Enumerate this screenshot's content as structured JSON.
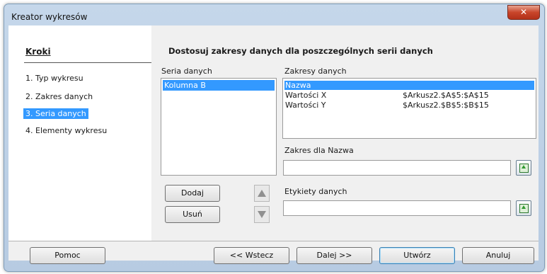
{
  "window": {
    "title": "Kreator wykresów",
    "close_label": "✕"
  },
  "steps": {
    "header": "Kroki",
    "items": [
      {
        "label": "1. Typ wykresu"
      },
      {
        "label": "2. Zakres danych"
      },
      {
        "label": "3. Seria danych"
      },
      {
        "label": "4. Elementy wykresu"
      }
    ],
    "selected_index": 2
  },
  "main": {
    "heading": "Dostosuj zakresy danych dla poszczególnych serii danych",
    "series_label": "Seria danych",
    "series_items": [
      "Kolumna B"
    ],
    "ranges_label": "Zakresy danych",
    "ranges": [
      {
        "name": "Nazwa",
        "value": ""
      },
      {
        "name": "Wartości X",
        "value": "$Arkusz2.$A$5:$A$15"
      },
      {
        "name": "Wartości Y",
        "value": "$Arkusz2.$B$5:$B$15"
      }
    ],
    "range_for_label": "Zakres dla Nazwa",
    "range_for_value": "",
    "data_labels_label": "Etykiety danych",
    "data_labels_value": "",
    "add_button": "Dodaj",
    "remove_button": "Usuń"
  },
  "footer": {
    "help": "Pomoc",
    "back": "<< Wstecz",
    "next": "Dalej >>",
    "finish": "Utwórz",
    "cancel": "Anuluj"
  }
}
